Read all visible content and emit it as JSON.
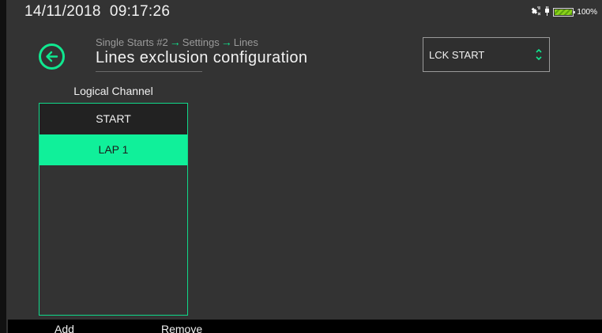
{
  "status_bar": {
    "datetime": "14/11/2018  09:17:26",
    "battery_percent": "100%",
    "battery_level": 1.0,
    "icons": [
      "satellite-icon",
      "plug-icon",
      "battery-icon"
    ]
  },
  "header": {
    "breadcrumb": [
      "Single Starts #2",
      "Settings",
      "Lines"
    ],
    "title": "Lines exclusion configuration"
  },
  "line_select": {
    "value": "LCK START"
  },
  "channel_list": {
    "heading": "Logical Channel",
    "items": [
      {
        "label": "START",
        "selected": false
      },
      {
        "label": "LAP 1",
        "selected": true
      }
    ]
  },
  "bottom_bar": {
    "add_label": "Add",
    "remove_label": "Remove"
  },
  "colors": {
    "accent": "#10f09a",
    "background": "#333333",
    "list_item": "#222222"
  }
}
